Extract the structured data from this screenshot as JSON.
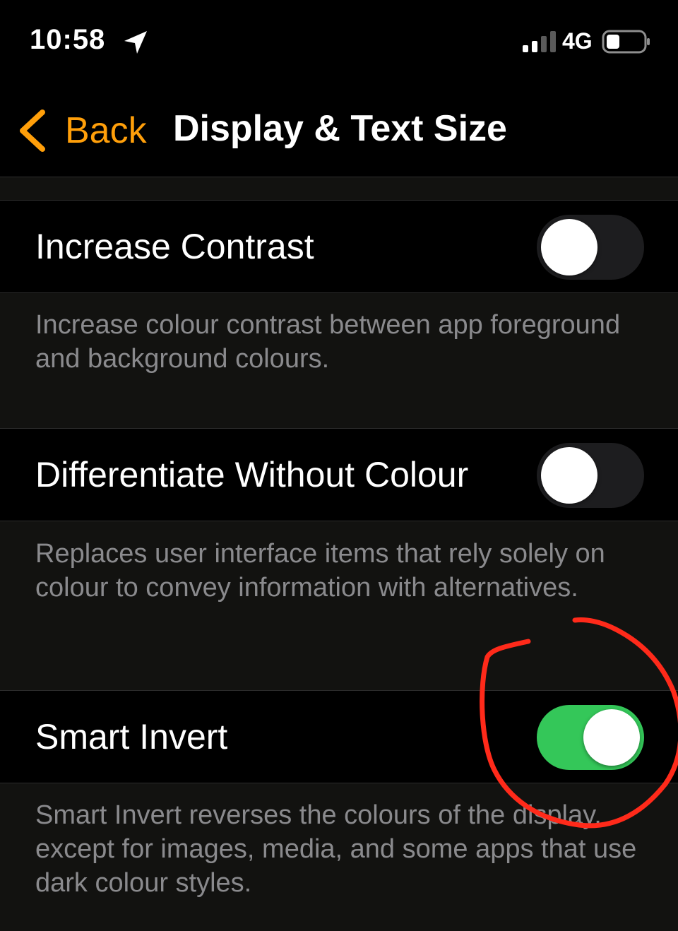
{
  "status_bar": {
    "time": "10:58",
    "network": "4G",
    "icons": [
      "location-arrow-icon",
      "cellular-signal-icon",
      "battery-icon"
    ]
  },
  "nav": {
    "back_label": "Back",
    "title": "Display & Text Size"
  },
  "settings": [
    {
      "label": "Increase Contrast",
      "enabled": false,
      "footer": "Increase colour contrast between app foreground and background colours."
    },
    {
      "label": "Differentiate Without Colour",
      "enabled": false,
      "footer": "Replaces user interface items that rely solely on colour to convey information with alternatives."
    },
    {
      "label": "Smart Invert",
      "enabled": true,
      "footer": "Smart Invert reverses the colours of the display, except for images, media, and some apps that use dark colour styles."
    }
  ],
  "colors": {
    "accent": "#ff9f0a",
    "toggle_on": "#34c759",
    "annotation": "#ff2a1a"
  }
}
